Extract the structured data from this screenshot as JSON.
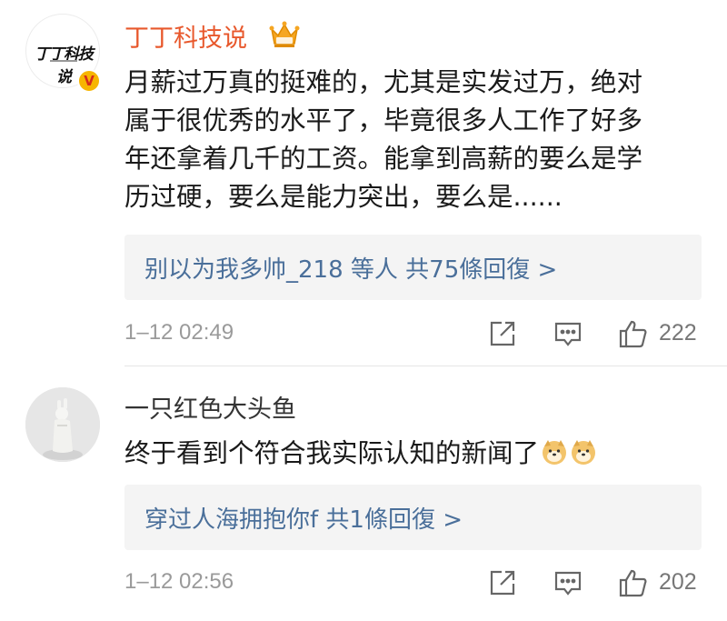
{
  "comments": [
    {
      "user": "丁丁科技说",
      "avatar_text": "丁丁科技说",
      "verified": "V",
      "lines": [
        "月薪过万真的挺难的，尤其是实发过万，绝对",
        "属于很优秀的水平了，毕竟很多人工作了好多",
        "年还拿着几千的工资。能拿到高薪的要么是学",
        "历过硬，要么是能力突出，要么是......"
      ],
      "replies_text": "别以为我多帅_218 等人 共75條回復 >",
      "time": "1–12 02:49",
      "likes": "222"
    },
    {
      "user": "一只红色大头鱼",
      "lines": [
        "终于看到个符合我实际认知的新闻了"
      ],
      "replies_text": "穿过人海拥抱你f  共1條回復 >",
      "time": "1–12 02:56",
      "likes": "202"
    }
  ],
  "icons": {
    "share": "share-icon",
    "reply": "comment-icon",
    "like": "thumbs-up-icon",
    "crown": "crown-badge-icon",
    "emoji": "doge-emoji-icon"
  },
  "colors": {
    "username_vip": "#e8582c",
    "link": "#4a6f9a",
    "meta": "#9a9a9a"
  }
}
